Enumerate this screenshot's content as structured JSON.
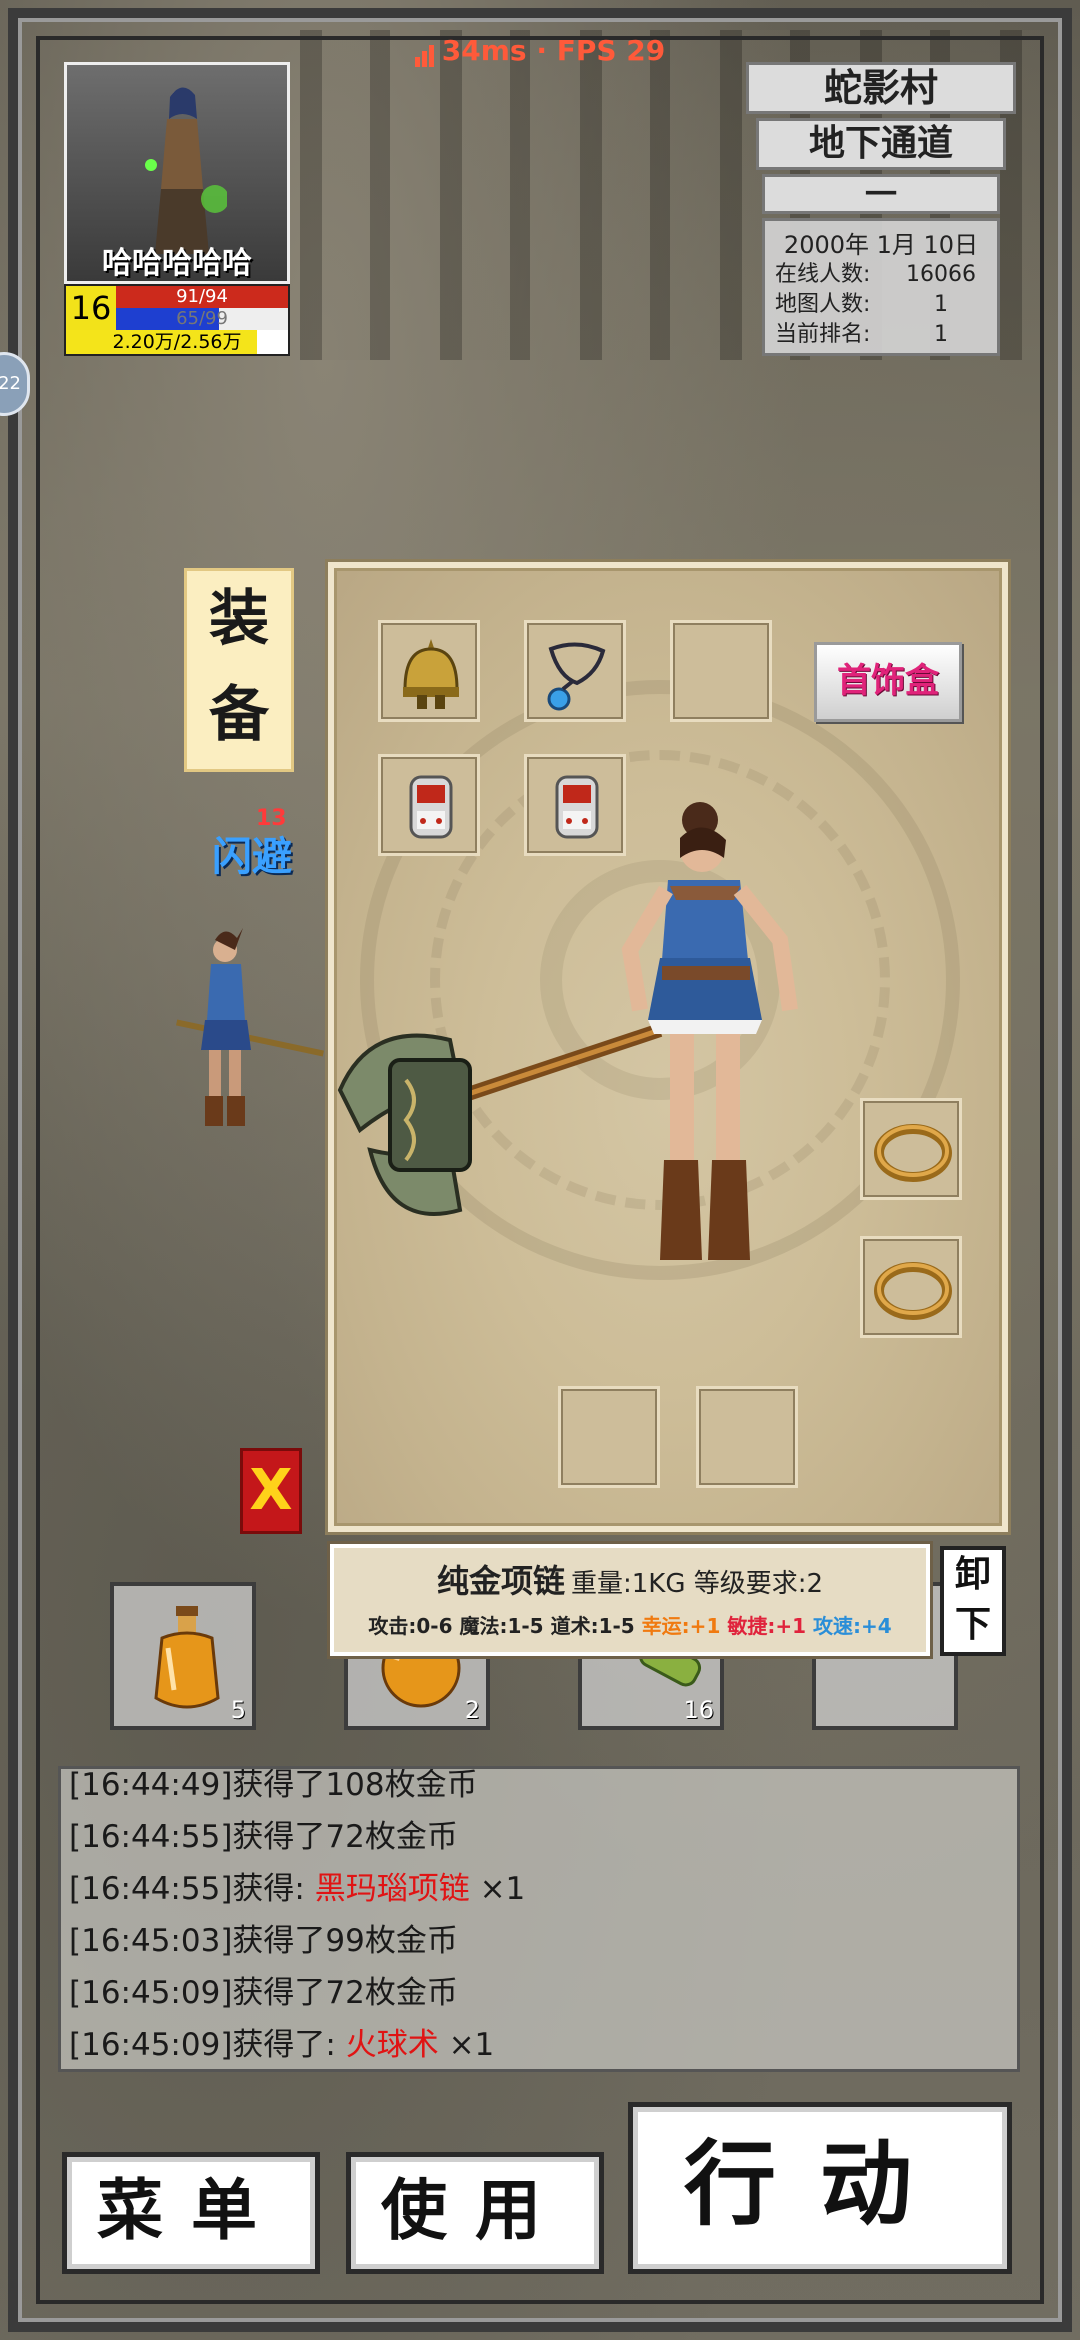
{
  "status": {
    "ping": "34ms",
    "sep": "·",
    "fps": "FPS 29"
  },
  "player": {
    "name": "哈哈哈哈哈",
    "level": "16",
    "hp": "91/94",
    "mp": "65/99",
    "exp": "2.20万/2.56万",
    "mp_fraction": 0.6,
    "exp_fraction": 0.86
  },
  "location": {
    "area": "蛇影村",
    "map": "地下通道",
    "sub": "一",
    "date": "2000年 1月 10日",
    "online_label": "在线人数:",
    "online_value": "16066",
    "map_count_label": "地图人数:",
    "map_count_value": "1",
    "rank_label": "当前排名:",
    "rank_value": "1"
  },
  "side_handle": "22",
  "equip_tab": {
    "line1": "装",
    "line2": "备"
  },
  "combat": {
    "dodge": "闪避",
    "num": "13"
  },
  "jewel_box": "首饰盒",
  "close_label": "X",
  "equipment_slots": [
    {
      "name": "helmet",
      "icon": "helmet-icon"
    },
    {
      "name": "necklace",
      "icon": "necklace-icon"
    },
    {
      "name": "empty",
      "icon": ""
    },
    {
      "name": "bracelet-left",
      "icon": "bracelet-icon"
    },
    {
      "name": "bracelet-right",
      "icon": "bracelet-icon"
    },
    {
      "name": "ring-1",
      "icon": "ring-icon"
    },
    {
      "name": "ring-2",
      "icon": "ring-icon"
    },
    {
      "name": "boots",
      "icon": ""
    },
    {
      "name": "belt",
      "icon": ""
    }
  ],
  "quickbar": [
    {
      "icon": "potion-bottle-icon",
      "count": "5"
    },
    {
      "icon": "orange-potion-icon",
      "count": "2"
    },
    {
      "icon": "scroll-icon",
      "count": "16"
    },
    {
      "icon": "",
      "count": ""
    }
  ],
  "tooltip": {
    "name": "纯金项链",
    "weight": "重量:1KG",
    "req": "等级要求:2",
    "attack": "攻击:0-6",
    "magic": "魔法:1-5",
    "tao": "道术:1-5",
    "luck": "幸运:+1",
    "agility": "敏捷:+1",
    "speed": "攻速:+4",
    "unequip_1": "卸",
    "unequip_2": "下"
  },
  "log": [
    {
      "prefix": "[16:44:49]获得了108枚金币",
      "item": "",
      "suffix": ""
    },
    {
      "prefix": "[16:44:55]获得了72枚金币",
      "item": "",
      "suffix": ""
    },
    {
      "prefix": "[16:44:55]获得: ",
      "item": "黑玛瑙项链",
      "suffix": " ×1"
    },
    {
      "prefix": "[16:45:03]获得了99枚金币",
      "item": "",
      "suffix": ""
    },
    {
      "prefix": "[16:45:09]获得了72枚金币",
      "item": "",
      "suffix": ""
    },
    {
      "prefix": "[16:45:09]获得了: ",
      "item": "火球术",
      "suffix": " ×1"
    }
  ],
  "buttons": {
    "menu": "菜单",
    "use": "使用",
    "action": "行动"
  },
  "colors": {
    "hp": "#cc2a1c",
    "mp": "#1e3fd0",
    "exp": "#f4e41a",
    "highlight": "#e01414",
    "jewel": "#e0237a"
  }
}
